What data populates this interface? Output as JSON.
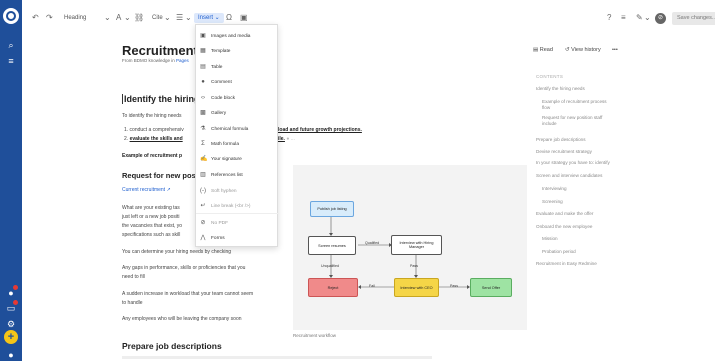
{
  "toolbar": {
    "undo_icon": "undo-icon",
    "redo_icon": "redo-icon",
    "heading_select": "Heading",
    "cite_label": "Cite",
    "insert_label": "Insert",
    "save_label": "Save changes...",
    "help": "?"
  },
  "page": {
    "title": "Recruitment",
    "from_prefix": "From BDMO knowledge in",
    "from_link": "Pages"
  },
  "insert_menu": [
    {
      "icon": "image-icon",
      "label": "Images and media"
    },
    {
      "icon": "template-icon",
      "label": "Template"
    },
    {
      "icon": "table-icon",
      "label": "Table"
    },
    {
      "icon": "comment-icon",
      "label": "Comment"
    },
    {
      "icon": "code-icon",
      "label": "Code block"
    },
    {
      "icon": "gallery-icon",
      "label": "Gallery"
    },
    {
      "icon": "flask-icon",
      "label": "Chemical formula"
    },
    {
      "icon": "sigma-icon",
      "label": "Math formula"
    },
    {
      "icon": "signature-icon",
      "label": "Your signature"
    },
    {
      "icon": "references-icon",
      "label": "References list"
    },
    {
      "icon": "hyphen-icon",
      "label": "Soft hyphen"
    },
    {
      "icon": "line-break-icon",
      "label": "Line break (<br />)"
    },
    {
      "icon": "no-pdf-icon",
      "label": "No PDF"
    },
    {
      "icon": "forms-icon",
      "label": "Forms"
    }
  ],
  "content": {
    "h_identify": "Identify the hiring",
    "p_identify": "To identify the hiring needs",
    "li1_pre": "1. conduct a comprehensiv",
    "li1_link": "load and future growth projections.",
    "li2_pre": "2.",
    "li2_ul": "evaluate the skills and",
    "li2_post": "ile.",
    "example": "Example of recruitment p",
    "h_request": "Request for new pos",
    "current_link": "Current recruitment",
    "p1": "What are your existing tas",
    "p2": "just left or a new job positi",
    "p3": "the vacancies that exist, yo",
    "p4": "specifications such as skill",
    "p5": "You can determine your hiring needs by checking",
    "p6a": "Any gaps in performance, skills or proficiencies that you",
    "p6b": "need to fill",
    "p7a": "A sudden increase in workload that your team cannot seem",
    "p7b": "to handle",
    "p8": "Any employees who will be leaving the company soon",
    "h_prepare": "Prepare job descriptions",
    "caption": "Recruitment workflow"
  },
  "right_panel": {
    "read_label": "Read",
    "history_label": "View history",
    "more": "•••",
    "contents_heading": "CONTENTS",
    "toc": [
      "Identify the hiring needs",
      "Example of recruitment process flow",
      "Request for new position staff include",
      "Prepare job descriptions",
      "Devise recruitment strategy",
      "In your strategy you have to: identify",
      "Screen and interview candidates",
      "Interviewing",
      "Screening",
      "Evaluate and make the offer",
      "Onboard the new employee",
      "Mission",
      "Probation period",
      "Recruitment in Easy Redmine"
    ]
  },
  "diagram": {
    "n_publish": "Publish job listing",
    "n_screen": "Screen resumes",
    "n_interview_hm": "Interview with Hiring Manager",
    "n_reject": "Reject",
    "n_interview_ceo": "Interview with CEO",
    "n_send_offer": "Send Offer",
    "e_qualified": "Qualified",
    "e_unqualified": "Unqualified",
    "e_pass1": "Pass",
    "e_fail": "Fail",
    "e_pass2": "Pass"
  },
  "colors": {
    "rail": "#1f4f9a",
    "publish": "#d8ecfb",
    "reject": "#f08a8a",
    "ceo": "#f5d547",
    "offer": "#9ee3a3"
  }
}
